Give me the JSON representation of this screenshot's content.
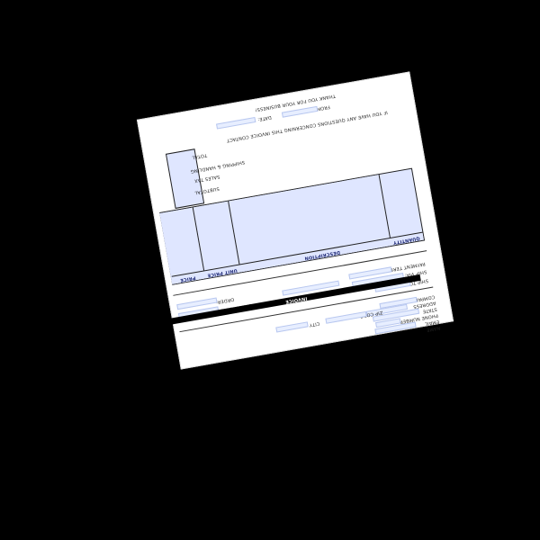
{
  "document": {
    "header_line": "THANK YOU FOR YOUR BUSINESS!",
    "from_label": "FROM:",
    "date_label": "DATE:",
    "note_line": "IF YOU HAVE ANY QUESTIONS CONCERNING THIS INVOICE CONTACT",
    "totals": {
      "total_label": "TOTAL",
      "shipping_label": "SHIPPING & HANDLING",
      "sales_tax_label": "SALES TAX",
      "subtotal_label": "SUBTOTAL"
    },
    "table": {
      "headers": {
        "quantity": "QUANTITY",
        "description": "DESCRIPTION",
        "unit_price": "UNIT PRICE",
        "price": "PRICE"
      }
    },
    "shipping_block": {
      "ship_to_label": "SHIP TO:",
      "order_label": "ORDER:",
      "shipping_method_label": "SHIPPING METHOD:",
      "order_number_label": "ORDER #:",
      "payment_terms_label": "PAYMENT TERMS:",
      "ship_via_label": "SHIP VIA:"
    },
    "section_label": "INVOICE",
    "bottom_block": {
      "name_label": "NAME",
      "address_label": "ADDRESS",
      "city_label": "CITY",
      "state_label": "STATE",
      "zip_label": "ZIP CODE",
      "phone_label": "PHONE NUMBER",
      "email_label": "EMAIL",
      "company_label": "COMPANY"
    }
  }
}
